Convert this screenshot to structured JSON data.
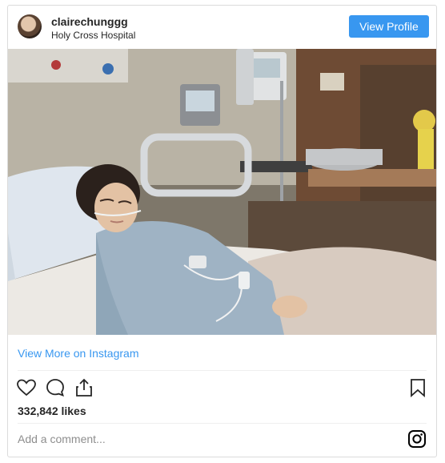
{
  "post": {
    "username": "clairechunggg",
    "location": "Holy Cross Hospital",
    "view_profile_label": "View Profile",
    "view_more_label": "View More on Instagram",
    "likes_text": "332,842 likes",
    "comment_placeholder": "Add a comment..."
  },
  "icons": {
    "like": "heart-icon",
    "comment": "speech-bubble-icon",
    "share": "share-icon",
    "save": "bookmark-icon",
    "brand": "instagram-icon"
  },
  "colors": {
    "accent": "#3897f0",
    "text": "#262626",
    "muted": "#8e8e8e",
    "border": "#dbdbdb"
  }
}
